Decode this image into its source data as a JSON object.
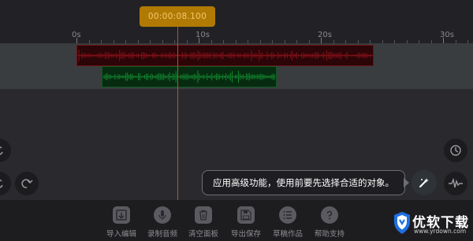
{
  "timecode": "00:00:08.100",
  "ruler": {
    "labels": [
      "0s",
      "10s",
      "20s",
      "30s"
    ]
  },
  "tooltip": {
    "text": "应用高级功能，使用前要先选择合适的对象。"
  },
  "toolbar": {
    "items": [
      {
        "label": "导入编辑",
        "icon": "import-icon"
      },
      {
        "label": "录制音频",
        "icon": "microphone-icon"
      },
      {
        "label": "清空面板",
        "icon": "trash-icon"
      },
      {
        "label": "导出保存",
        "icon": "save-icon"
      },
      {
        "label": "草稿作品",
        "icon": "list-icon"
      },
      {
        "label": "帮助支持",
        "icon": "help-icon"
      }
    ]
  },
  "side_buttons": {
    "left": [
      "undo-icon",
      "redo-icon"
    ],
    "right": [
      "clock-icon",
      "waveform-icon",
      "magic-wand-icon"
    ]
  },
  "watermark": {
    "brand": "优软下载",
    "url": "www.yrdown.com"
  },
  "colors": {
    "timecode_bg": "#b07a05",
    "clip_red": "#8a1018",
    "clip_green": "#148a30",
    "playhead": "#c0502a"
  }
}
